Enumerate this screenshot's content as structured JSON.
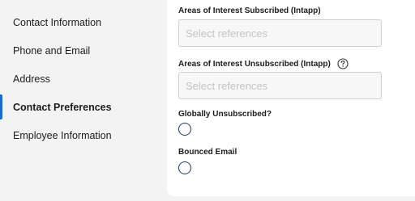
{
  "sidebar": {
    "items": [
      {
        "label": "Contact Information"
      },
      {
        "label": "Phone and Email"
      },
      {
        "label": "Address"
      },
      {
        "label": "Contact Preferences",
        "active": true
      },
      {
        "label": "Employee Information"
      }
    ],
    "accent_color": "#0f6fd4"
  },
  "form": {
    "subscribed": {
      "label": "Areas of Interest Subscribed (Intapp)",
      "placeholder": "Select references",
      "value": ""
    },
    "unsubscribed": {
      "label": "Areas of Interest Unsubscribed (Intapp)",
      "placeholder": "Select references",
      "value": "",
      "help_icon": "question-circle-icon"
    },
    "globally_unsubscribed": {
      "label": "Globally Unsubscribed?",
      "checked": false
    },
    "bounced_email": {
      "label": "Bounced Email",
      "checked": false
    },
    "radio_color": "#1e3a6e"
  }
}
